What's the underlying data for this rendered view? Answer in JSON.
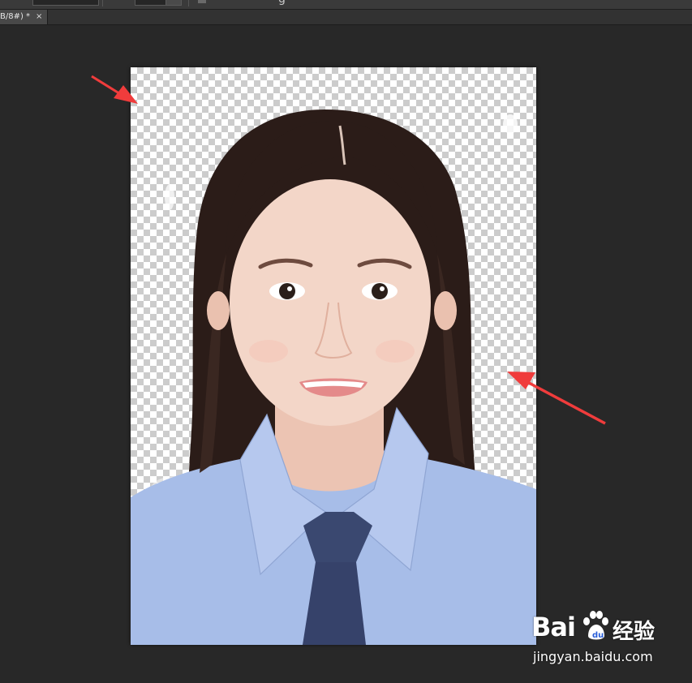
{
  "document_tab": {
    "title": "B/8#) *",
    "close_glyph": "×"
  },
  "options_bar": {
    "partial_glyph": "g"
  },
  "canvas": {
    "content": "ID photo portrait on transparent (checkerboard) background",
    "shirt_color": "#a7bde8",
    "tie_color": "#3a4870",
    "hair_color": "#2b1c18",
    "skin_color": "#f3d6c8"
  },
  "annotations": {
    "arrow_color": "#f03c3c",
    "arrows": [
      "arrow-top-left",
      "arrow-right"
    ]
  },
  "watermark": {
    "brand": "Bai",
    "brand_suffix": "",
    "chinese": "经验",
    "url": "jingyan.baidu.com"
  }
}
